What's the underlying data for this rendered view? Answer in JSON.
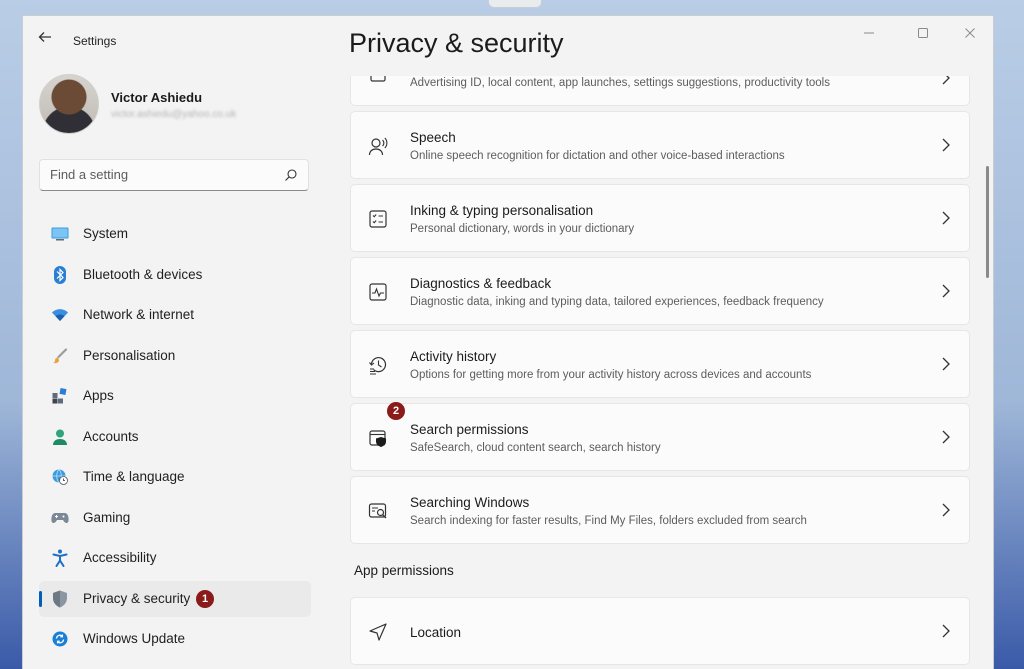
{
  "window": {
    "title": "Settings",
    "minimize_icon": "minimize-icon",
    "maximize_icon": "maximize-icon",
    "close_icon": "close-icon"
  },
  "profile": {
    "name": "Victor Ashiedu",
    "email": "victor.ashiedu@yahoo.co.uk"
  },
  "search": {
    "placeholder": "Find a setting"
  },
  "sidebar": {
    "items": [
      {
        "label": "System",
        "icon": "monitor-icon"
      },
      {
        "label": "Bluetooth & devices",
        "icon": "bluetooth-icon"
      },
      {
        "label": "Network & internet",
        "icon": "wifi-icon"
      },
      {
        "label": "Personalisation",
        "icon": "brush-icon"
      },
      {
        "label": "Apps",
        "icon": "apps-icon"
      },
      {
        "label": "Accounts",
        "icon": "person-icon"
      },
      {
        "label": "Time & language",
        "icon": "globe-clock-icon"
      },
      {
        "label": "Gaming",
        "icon": "gamepad-icon"
      },
      {
        "label": "Accessibility",
        "icon": "accessibility-icon"
      },
      {
        "label": "Privacy & security",
        "icon": "shield-icon",
        "active": true,
        "badge": "1"
      },
      {
        "label": "Windows Update",
        "icon": "update-icon"
      }
    ]
  },
  "page": {
    "title": "Privacy & security"
  },
  "cards": [
    {
      "title": "",
      "subtitle": "Advertising ID, local content, app launches, settings suggestions, productivity tools",
      "icon": "lock-icon"
    },
    {
      "title": "Speech",
      "subtitle": "Online speech recognition for dictation and other voice-based interactions",
      "icon": "speech-icon"
    },
    {
      "title": "Inking & typing personalisation",
      "subtitle": "Personal dictionary, words in your dictionary",
      "icon": "checklist-icon"
    },
    {
      "title": "Diagnostics & feedback",
      "subtitle": "Diagnostic data, inking and typing data, tailored experiences, feedback frequency",
      "icon": "pulse-icon"
    },
    {
      "title": "Activity history",
      "subtitle": "Options for getting more from your activity history across devices and accounts",
      "icon": "history-icon"
    },
    {
      "title": "Search permissions",
      "subtitle": "SafeSearch, cloud content search, search history",
      "icon": "search-shield-icon",
      "badge": "2"
    },
    {
      "title": "Searching Windows",
      "subtitle": "Search indexing for faster results, Find My Files, folders excluded from search",
      "icon": "search-window-icon"
    }
  ],
  "app_permissions": {
    "header": "App permissions",
    "items": [
      {
        "title": "Location",
        "icon": "location-icon"
      }
    ]
  },
  "colors": {
    "accent": "#005fb8",
    "badge": "#8b1a1a"
  }
}
